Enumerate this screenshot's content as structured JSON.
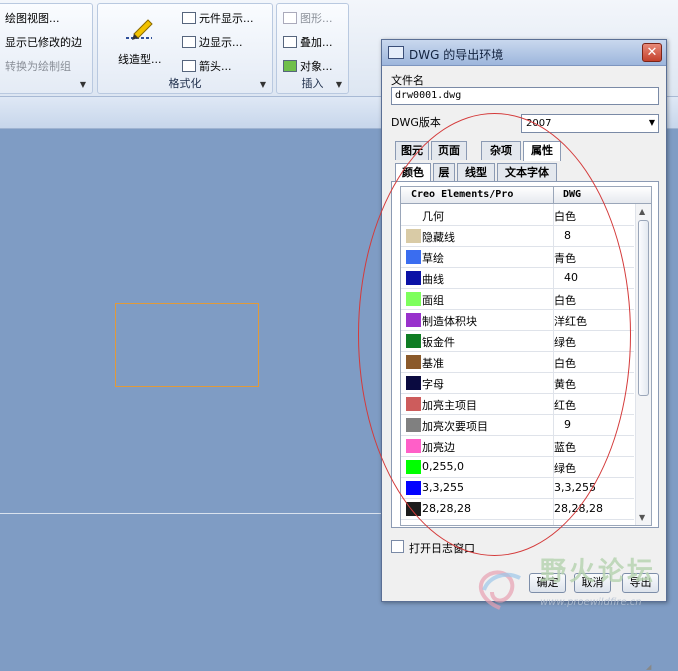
{
  "ribbon": {
    "group1": {
      "items": [
        "绘图视图...",
        "显示已修改的边",
        "转换为绘制组"
      ]
    },
    "format_group": {
      "label": "格式化",
      "line_style": "线造型...",
      "element_display": "元件显示...",
      "edge_display": "边显示...",
      "arrow": "箭头..."
    },
    "insert_group": {
      "label": "插入",
      "graphics": "图形...",
      "overlay": "叠加...",
      "object": "对象..."
    }
  },
  "dialog": {
    "title": "DWG 的导出环境",
    "filename_label": "文件名",
    "filename_value": "drw0001.dwg",
    "version_label": "DWG版本",
    "version_value": "2007",
    "tabs": [
      "图元",
      "页面",
      "杂项",
      "属性"
    ],
    "subtabs": [
      "颜色",
      "层",
      "线型",
      "文本字体"
    ],
    "table_headers": [
      "Creo Elements/Pro",
      "DWG"
    ],
    "rows": [
      {
        "name": "几何",
        "value": "白色",
        "swatch": "#ffffff"
      },
      {
        "name": "隐藏线",
        "value": "8",
        "swatch": "#d9cba6"
      },
      {
        "name": "草绘",
        "value": "青色",
        "swatch": "#3a6df0"
      },
      {
        "name": "曲线",
        "value": "40",
        "swatch": "#0b12a6"
      },
      {
        "name": "面组",
        "value": "白色",
        "swatch": "#7dff5c"
      },
      {
        "name": "制造体积块",
        "value": "洋红色",
        "swatch": "#9932cc"
      },
      {
        "name": "钣金件",
        "value": "绿色",
        "swatch": "#0f7d24"
      },
      {
        "name": "基准",
        "value": "白色",
        "swatch": "#8b5a2b"
      },
      {
        "name": "字母",
        "value": "黄色",
        "swatch": "#0a0a40"
      },
      {
        "name": "加亮主项目",
        "value": "红色",
        "swatch": "#cd5c5c"
      },
      {
        "name": "加亮次要项目",
        "value": "9",
        "swatch": "#808080"
      },
      {
        "name": "加亮边",
        "value": "蓝色",
        "swatch": "#ff5fc8"
      },
      {
        "name": "0,255,0",
        "value": "绿色",
        "swatch": "#00ff00"
      },
      {
        "name": "3,3,255",
        "value": "3,3,255",
        "swatch": "#0303ff"
      },
      {
        "name": "28,28,28",
        "value": "28,28,28",
        "swatch": "#1c1c1c"
      }
    ],
    "log_checkbox_label": "打开日志窗口",
    "buttons": {
      "ok": "确定",
      "cancel": "取消",
      "export": "导出"
    }
  },
  "watermark": {
    "site_name": "野火论坛",
    "url": "www.proewildfire.cn"
  }
}
